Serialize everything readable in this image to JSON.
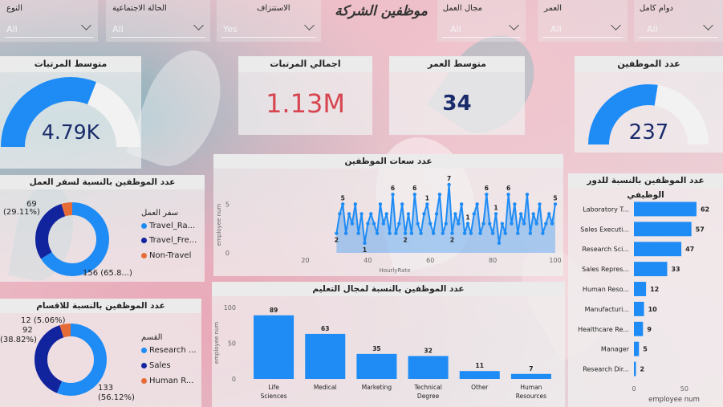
{
  "colors": {
    "blue": "#1f8cf5",
    "navy": "#12239e",
    "orange": "#e66c37",
    "red": "#d64550",
    "dark_navy": "#1a2b6b"
  },
  "header": {
    "title": "موظفين الشركة"
  },
  "slicers": [
    {
      "label": "النوع",
      "value": "All"
    },
    {
      "label": "الحالة الاجتماعية",
      "value": "All"
    },
    {
      "label": "الاستنزاف",
      "value": "Yes"
    },
    {
      "label": "مجال العمل",
      "value": "All"
    },
    {
      "label": "العمر",
      "value": "All"
    },
    {
      "label": "دوام كامل",
      "value": "All"
    }
  ],
  "kpis": {
    "avg_salary": {
      "title": "متوسط المرتبات",
      "value": "4.79K",
      "gauge_fraction": 0.62
    },
    "total_salary": {
      "title": "اجمالي المرتبات",
      "value": "1.13M"
    },
    "avg_age": {
      "title": "متوسط العمر",
      "value": "34"
    },
    "emp_count": {
      "title": "عدد الموظفين",
      "value": "237",
      "gauge_fraction": 0.55
    }
  },
  "travel_donut": {
    "title": "عدد الموظفين بالنسبة لسفر العمل",
    "legend_title": "سفر العمل",
    "items": [
      {
        "label": "Travel_Ra...",
        "color": "#1f8cf5"
      },
      {
        "label": "Travel_Fre...",
        "color": "#12239e"
      },
      {
        "label": "Non-Travel",
        "color": "#e66c37"
      }
    ],
    "labels": {
      "top": "69",
      "top_pct": "(29.11%)",
      "bottom": "156 (65.8...)"
    }
  },
  "dept_donut": {
    "title": "عدد الموظفين بالنسبة للاقسام",
    "legend_title": "القسم",
    "items": [
      {
        "label": "Research ...",
        "color": "#1f8cf5"
      },
      {
        "label": "Sales",
        "color": "#12239e"
      },
      {
        "label": "Human R...",
        "color": "#e66c37"
      }
    ],
    "labels": {
      "a": "12 (5.06%)",
      "b": "92",
      "b_pct": "(38.82%)",
      "c": "133",
      "c_pct": "(56.12%)"
    }
  },
  "chart_data": [
    {
      "type": "line",
      "title": "عدد سعات الموظفين",
      "xlabel": "HourlyRate",
      "ylabel": "employee num",
      "x_ticks": [
        "20",
        "40",
        "60",
        "80",
        "100"
      ],
      "y_ticks": [
        "0",
        "5"
      ],
      "xlim": [
        15,
        100
      ],
      "ylim": [
        0,
        7
      ],
      "x": [
        30,
        31,
        32,
        33,
        34,
        35,
        36,
        37,
        38,
        39,
        40,
        41,
        42,
        43,
        44,
        45,
        46,
        47,
        48,
        49,
        50,
        51,
        52,
        53,
        54,
        55,
        56,
        57,
        58,
        59,
        60,
        61,
        62,
        63,
        64,
        65,
        66,
        67,
        68,
        69,
        70,
        71,
        72,
        73,
        74,
        75,
        76,
        77,
        78,
        79,
        80,
        81,
        82,
        83,
        84,
        85,
        86,
        87,
        88,
        89,
        90,
        91,
        92,
        93,
        94,
        95,
        96,
        97,
        98,
        99,
        100
      ],
      "values": [
        2,
        4,
        5,
        2,
        4,
        3,
        5,
        2,
        4,
        1,
        3,
        4,
        3,
        2,
        5,
        3,
        4,
        2,
        6,
        2,
        3,
        5,
        2,
        4,
        2,
        6,
        3,
        2,
        4,
        5,
        3,
        2,
        4,
        6,
        2,
        3,
        7,
        2,
        4,
        3,
        5,
        2,
        3,
        2,
        4,
        5,
        2,
        3,
        6,
        3,
        2,
        4,
        1,
        3,
        2,
        6,
        3,
        5,
        2,
        4,
        3,
        6,
        2,
        4,
        3,
        5,
        2,
        3,
        4,
        3,
        5
      ],
      "point_labels": [
        {
          "x": 30,
          "text": "2"
        },
        {
          "x": 32,
          "text": "5"
        },
        {
          "x": 39,
          "text": "1"
        },
        {
          "x": 48,
          "text": "6"
        },
        {
          "x": 52,
          "text": "2"
        },
        {
          "x": 55,
          "text": "6"
        },
        {
          "x": 59,
          "text": "1"
        },
        {
          "x": 66,
          "text": "7"
        },
        {
          "x": 67,
          "text": "2"
        },
        {
          "x": 72,
          "text": "1"
        },
        {
          "x": 78,
          "text": "6"
        },
        {
          "x": 81,
          "text": "1"
        },
        {
          "x": 85,
          "text": "6"
        },
        {
          "x": 100,
          "text": "5"
        }
      ]
    },
    {
      "type": "bar",
      "title": "عدد الموظفين بالنسبة لمجال التعليم",
      "ylabel": "employee num",
      "categories": [
        "Life Sciences",
        "Medical",
        "Marketing",
        "Technical Degree",
        "Other",
        "Human Resources"
      ],
      "values": [
        89,
        63,
        35,
        32,
        11,
        7
      ],
      "y_ticks": [
        "0",
        "50",
        "100"
      ],
      "ylim": [
        0,
        100
      ]
    },
    {
      "type": "bar",
      "orientation": "horizontal",
      "title": "عدد الموظفين بالنسبة للدور الوظيفي",
      "xlabel": "employee num",
      "categories": [
        "Laboratory T...",
        "Sales Executi...",
        "Research Sci...",
        "Sales Repres...",
        "Human Reso...",
        "Manufacturi...",
        "Healthcare Re...",
        "Manager",
        "Research Dir..."
      ],
      "values": [
        62,
        57,
        47,
        33,
        12,
        10,
        9,
        5,
        2
      ],
      "x_ticks": [
        "0",
        "50"
      ],
      "xlim": [
        0,
        70
      ]
    }
  ]
}
